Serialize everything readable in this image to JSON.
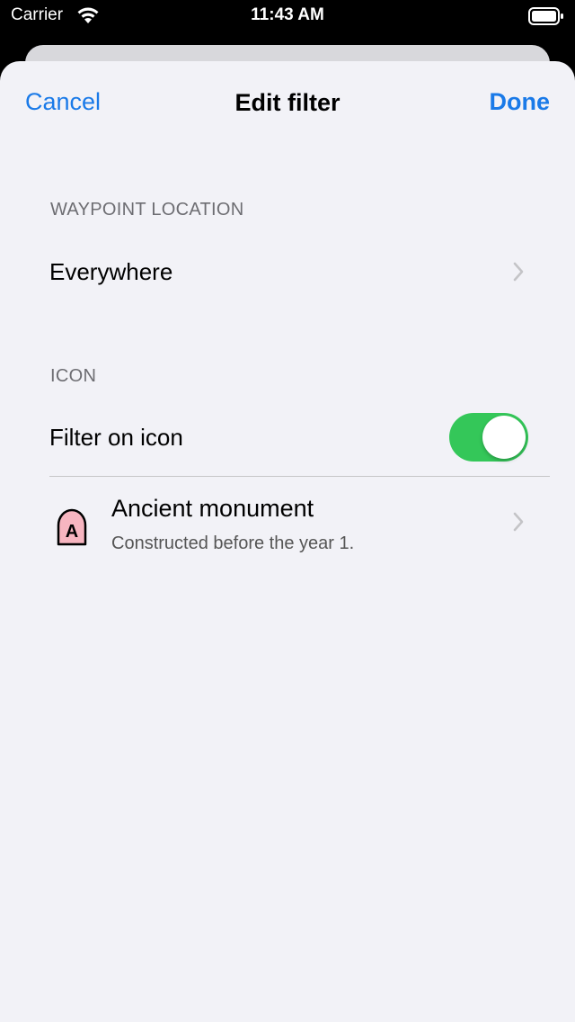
{
  "status_bar": {
    "carrier": "Carrier",
    "time": "11:43 AM",
    "icons": [
      "wifi-icon",
      "battery-icon"
    ]
  },
  "nav": {
    "cancel_label": "Cancel",
    "title": "Edit filter",
    "done_label": "Done"
  },
  "sections": {
    "location": {
      "header": "WAYPOINT LOCATION",
      "value": "Everywhere"
    },
    "icon": {
      "header": "ICON",
      "toggle_label": "Filter on icon",
      "toggle_on": true,
      "waypoint": {
        "title": "Ancient monument",
        "subtitle": "Constructed before the year 1.",
        "badge_letter": "A"
      }
    }
  },
  "colors": {
    "accent": "#1a7ae8",
    "toggle_on": "#34c759",
    "background": "#f2f2f7",
    "icon_fill": "#f7b5c0"
  }
}
